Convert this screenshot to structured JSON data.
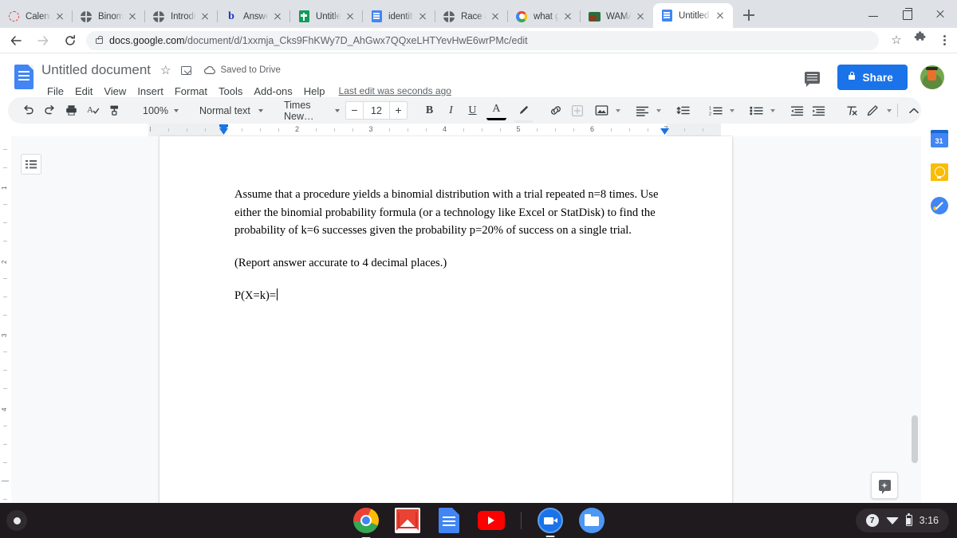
{
  "browser": {
    "tabs": [
      {
        "title": "Calendar",
        "favicon": "calendar-icon",
        "active": false
      },
      {
        "title": "BinomialProbability",
        "favicon": "globe-icon",
        "active": false
      },
      {
        "title": "Introduction to",
        "favicon": "globe-icon",
        "active": false
      },
      {
        "title": "Answered: Assume",
        "favicon": "brainly-icon",
        "active": false
      },
      {
        "title": "Untitled spreadsheet",
        "favicon": "sheets-icon",
        "active": false
      },
      {
        "title": "identity without",
        "favicon": "docs-icon",
        "active": false
      },
      {
        "title": "Race and",
        "favicon": "globe-icon",
        "active": false
      },
      {
        "title": "what generation",
        "favicon": "google-icon",
        "active": false
      },
      {
        "title": "WAMAP Assessment",
        "favicon": "wamap-icon",
        "active": false
      },
      {
        "title": "Untitled document",
        "favicon": "docs-icon",
        "active": true
      }
    ],
    "new_tab_label": "+",
    "url_host": "docs.google.com",
    "url_path": "/document/d/1xxmja_Cks9FhKWy7D_AhGwx7QQxeLHTYevHwE6wrPMc/edit",
    "window_controls": {
      "minimize": "minimize-icon",
      "maximize": "maximize-icon",
      "close": "close-icon"
    },
    "toolbar_icons": {
      "back": "back-arrow-icon",
      "forward": "forward-arrow-icon",
      "reload": "reload-icon",
      "bookmark": "star-icon",
      "extensions": "puzzle-icon",
      "menu": "kebab-menu-icon"
    }
  },
  "docs": {
    "title": "Untitled document",
    "save_state": "Saved to Drive",
    "menus": [
      "File",
      "Edit",
      "View",
      "Insert",
      "Format",
      "Tools",
      "Add-ons",
      "Help"
    ],
    "last_edit": "Last edit was seconds ago",
    "share_label": "Share",
    "toolbar": {
      "zoom": "100%",
      "style": "Normal text",
      "font": "Times New…",
      "font_size": "12",
      "decrease": "−",
      "increase": "+",
      "bold": "B",
      "italic": "I",
      "underline": "U",
      "text_color": "A"
    },
    "ruler": {
      "horizontal_labels": [
        "1",
        "1",
        "2",
        "3",
        "4",
        "5",
        "6",
        "7"
      ],
      "vertical_labels": [
        "1",
        "2",
        "3",
        "4"
      ]
    },
    "body": {
      "paragraph1": "Assume that a procedure yields a binomial distribution with a trial repeated n=8 times. Use either the binomial probability formula (or a technology like Excel or StatDisk) to find the probability of k=6 successes given the probability p=20%  of success on a single trial.",
      "paragraph2": "(Report answer accurate to 4 decimal places.)",
      "paragraph3": "P(X=k)="
    },
    "side_panel": [
      "calendar-icon",
      "keep-icon",
      "tasks-icon"
    ],
    "calendar_day": "31"
  },
  "shelf": {
    "apps": [
      "chrome-icon",
      "gmail-icon",
      "docs-icon",
      "youtube-icon",
      "meet-icon",
      "files-icon"
    ],
    "notification_count": "7",
    "time": "3:16",
    "status_icons": [
      "wifi-icon",
      "battery-icon"
    ]
  },
  "colors": {
    "accent": "#1a73e8",
    "tabstrip": "#dee1e6",
    "toolbar_bg": "#f1f3f4",
    "workspace_bg": "#f8f9fa",
    "shelf_bg": "#1e1a1d"
  }
}
